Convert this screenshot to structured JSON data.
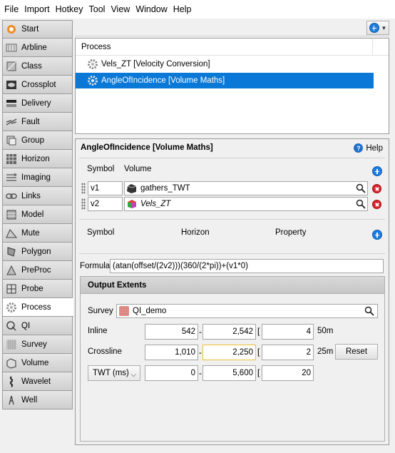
{
  "menu": [
    "File",
    "Import",
    "Hotkey",
    "Tool",
    "View",
    "Window",
    "Help"
  ],
  "sidebar": {
    "items": [
      {
        "label": "Start",
        "icon": "start-icon"
      },
      {
        "label": "Arbline",
        "icon": "arbline-icon"
      },
      {
        "label": "Class",
        "icon": "class-icon"
      },
      {
        "label": "Crossplot",
        "icon": "crossplot-icon"
      },
      {
        "label": "Delivery",
        "icon": "delivery-icon"
      },
      {
        "label": "Fault",
        "icon": "fault-icon"
      },
      {
        "label": "Group",
        "icon": "group-icon"
      },
      {
        "label": "Horizon",
        "icon": "horizon-icon"
      },
      {
        "label": "Imaging",
        "icon": "imaging-icon"
      },
      {
        "label": "Links",
        "icon": "links-icon"
      },
      {
        "label": "Model",
        "icon": "model-icon"
      },
      {
        "label": "Mute",
        "icon": "mute-icon"
      },
      {
        "label": "Polygon",
        "icon": "polygon-icon"
      },
      {
        "label": "PreProc",
        "icon": "preproc-icon"
      },
      {
        "label": "Probe",
        "icon": "probe-icon"
      },
      {
        "label": "Process",
        "icon": "gear-icon"
      },
      {
        "label": "QI",
        "icon": "qi-icon"
      },
      {
        "label": "Survey",
        "icon": "survey-icon"
      },
      {
        "label": "Volume",
        "icon": "volume-icon"
      },
      {
        "label": "Wavelet",
        "icon": "wavelet-icon"
      },
      {
        "label": "Well",
        "icon": "well-icon"
      }
    ],
    "active": "Process"
  },
  "process_list": {
    "header": "Process",
    "rows": [
      {
        "label": "Vels_ZT [Velocity Conversion]",
        "selected": false
      },
      {
        "label": "AngleOfIncidence [Volume Maths]",
        "selected": true
      }
    ]
  },
  "editor": {
    "title": "AngleOfIncidence [Volume Maths]",
    "help_label": "Help",
    "vol_headers": {
      "symbol": "Symbol",
      "volume": "Volume"
    },
    "volumes": [
      {
        "symbol": "v1",
        "name": "gathers_TWT"
      },
      {
        "symbol": "v2",
        "name": "Vels_ZT"
      }
    ],
    "hz_headers": {
      "symbol": "Symbol",
      "horizon": "Horizon",
      "property": "Property"
    },
    "formula_label": "Formula",
    "formula": "(atan(offset/(2v2)))(360/(2*pi))+(v1*0)"
  },
  "extents": {
    "title": "Output Extents",
    "survey_label": "Survey",
    "survey": "QI_demo",
    "inline": {
      "label": "Inline",
      "from": "542",
      "to": "2,542",
      "step": "4",
      "unit": "50m"
    },
    "crossline": {
      "label": "Crossline",
      "from": "1,010",
      "to": "2,250",
      "step": "2",
      "unit": "25m"
    },
    "twt": {
      "label": "TWT (ms)",
      "from": "0",
      "to": "5,600",
      "step": "20"
    },
    "reset_label": "Reset",
    "dash": "-",
    "bracket": "["
  },
  "colors": {
    "selection": "#0a78d7",
    "accent": "#1f7de0",
    "remove": "#d9262c",
    "highlight_border": "#f0c030"
  }
}
